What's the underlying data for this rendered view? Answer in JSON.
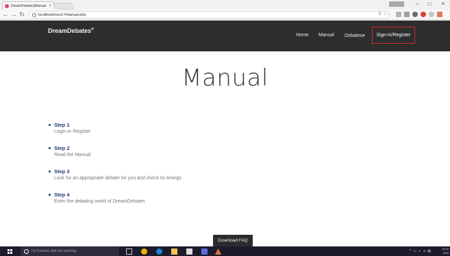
{
  "browser": {
    "tab_title": "DreamDebates|Manual",
    "tab_close": "×",
    "url": "localhost/ices17/manual.php",
    "window_controls": {
      "minimize": "–",
      "maximize": "□",
      "close": "×"
    },
    "nav_icons": [
      "back-arrow-icon",
      "forward-arrow-icon",
      "reload-icon"
    ]
  },
  "site": {
    "brand": "DreamDebates",
    "brand_mark": "®",
    "nav": {
      "home": "Home",
      "manual": "Manual",
      "debates": "Debates",
      "debates_caret": "▾",
      "signin": "Sign-in/Register"
    },
    "accent_color": "#c9302c",
    "nav_bg": "#2d2d2d"
  },
  "main": {
    "title": "Manual",
    "steps": [
      {
        "title": "Step 1",
        "description": "Login or Register"
      },
      {
        "title": "Step 2",
        "description": "Read the Manual"
      },
      {
        "title": "Step 3",
        "description": "Look for an appropriate debate for you and check its timings"
      },
      {
        "title": "Step 4",
        "description": "Enter the debating world of DreamDebates"
      }
    ],
    "faq_button": "Download FAQ",
    "step_color": "#1e3b73"
  },
  "taskbar": {
    "cortana_placeholder": "I'm Cortana. Ask me anything.",
    "clock_time": "10:40",
    "clock_date": "1/5/2"
  }
}
